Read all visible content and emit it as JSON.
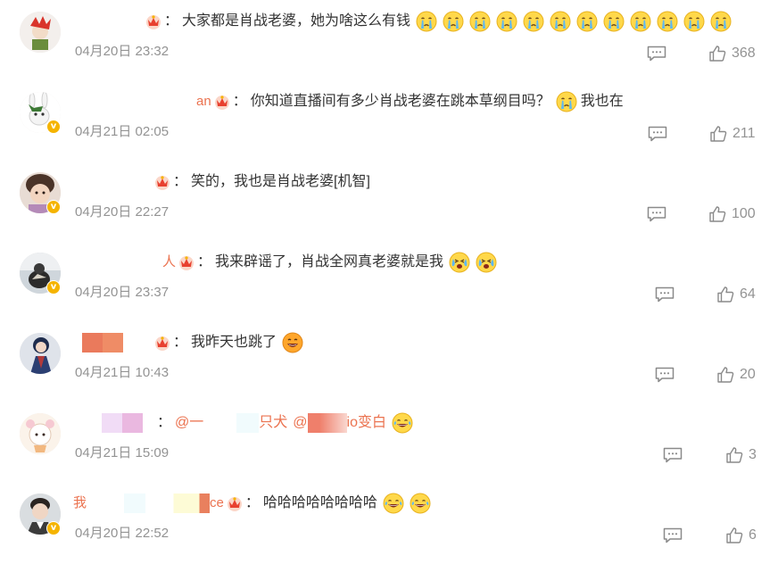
{
  "comments": [
    {
      "username": "",
      "username_tail": "",
      "text": "大家都是肖战老婆，她为啥这么有钱",
      "emoji": [
        "crying-face",
        "crying-face",
        "crying-face",
        "crying-face",
        "crying-face",
        "crying-face",
        "crying-face",
        "crying-face",
        "crying-face",
        "crying-face",
        "crying-face",
        "crying-face"
      ],
      "time": "04月20日 23:32",
      "likes": "368",
      "verified": false
    },
    {
      "username": "an",
      "username_tail": "",
      "text": "你知道直播间有多少肖战老婆在跳本草纲目吗？",
      "emoji": [
        "crying-face"
      ],
      "text_after": "我也在",
      "time": "04月21日 02:05",
      "likes": "211",
      "verified": true
    },
    {
      "username": "",
      "username_tail": "",
      "text": "笑的，我也是肖战老婆[机智]",
      "emoji": [],
      "time": "04月20日 22:27",
      "likes": "100",
      "verified": true
    },
    {
      "username": "人",
      "username_tail": "",
      "text": "我来辟谣了，肖战全网真老婆就是我",
      "emoji": [
        "laugh-cry-face",
        "laugh-cry-face"
      ],
      "time": "04月20日 23:37",
      "likes": "64",
      "verified": true
    },
    {
      "username": "",
      "username_tail": "",
      "text": "我昨天也跳了",
      "emoji": [
        "grin-face"
      ],
      "time": "04月21日 10:43",
      "likes": "20",
      "verified": false
    },
    {
      "username": "",
      "username_tail": "",
      "mention1": "@一",
      "mention_mid": "只犬",
      "mention2": "@",
      "mention_tail": "io变白",
      "emoji": [
        "tears-of-joy-face"
      ],
      "time": "04月21日 15:09",
      "likes": "3",
      "verified": false
    },
    {
      "username": "我",
      "username_tail": "ce",
      "text": "哈哈哈哈哈哈哈哈",
      "emoji": [
        "tears-of-joy-face",
        "tears-of-joy-face"
      ],
      "time": "04月20日 22:52",
      "likes": "6",
      "verified": true
    }
  ],
  "colors": {
    "username": "#eb7350",
    "meta": "#939393",
    "text": "#333333",
    "verified_badge": "#f5b400"
  },
  "icons": {
    "reply": "reply-icon",
    "like": "thumb-up-icon",
    "member": "crown-badge-icon"
  }
}
